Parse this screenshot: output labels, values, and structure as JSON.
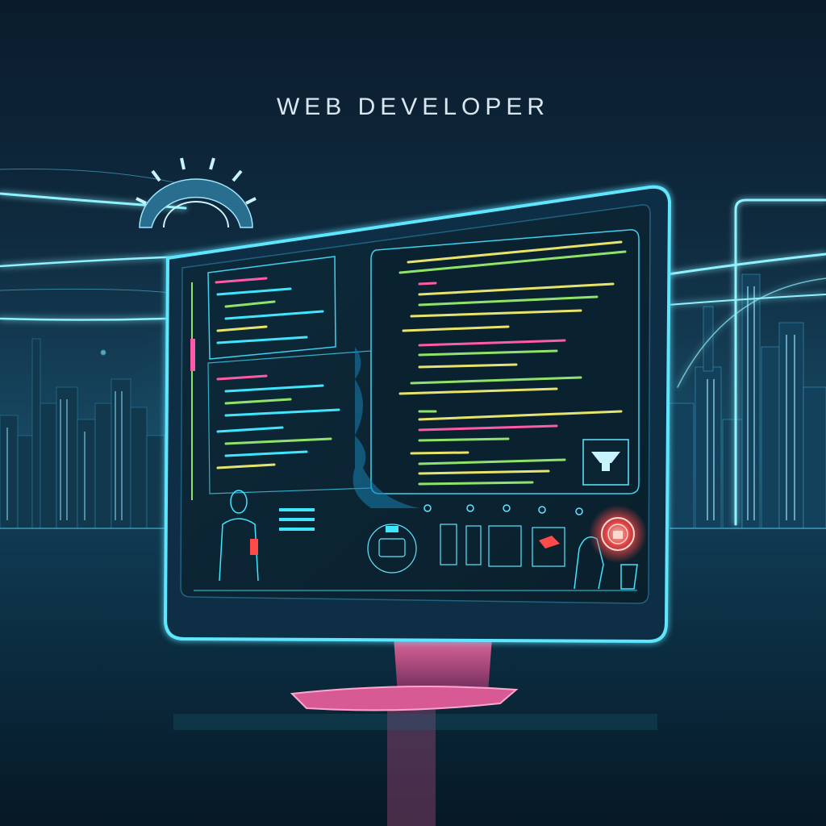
{
  "header": {
    "title": "WEB DEVELOPER"
  },
  "colors": {
    "accent": "#3ee6ff",
    "code_green": "#8fe36b",
    "code_pink": "#ff5aa8",
    "code_yellow": "#e8e36a",
    "alert_red": "#ff4a4a",
    "stand_pink": "#e0679a"
  },
  "icons": [
    "gear-icon",
    "person-icon",
    "lock-button-icon",
    "chip-icon",
    "fingerprint-icon"
  ]
}
